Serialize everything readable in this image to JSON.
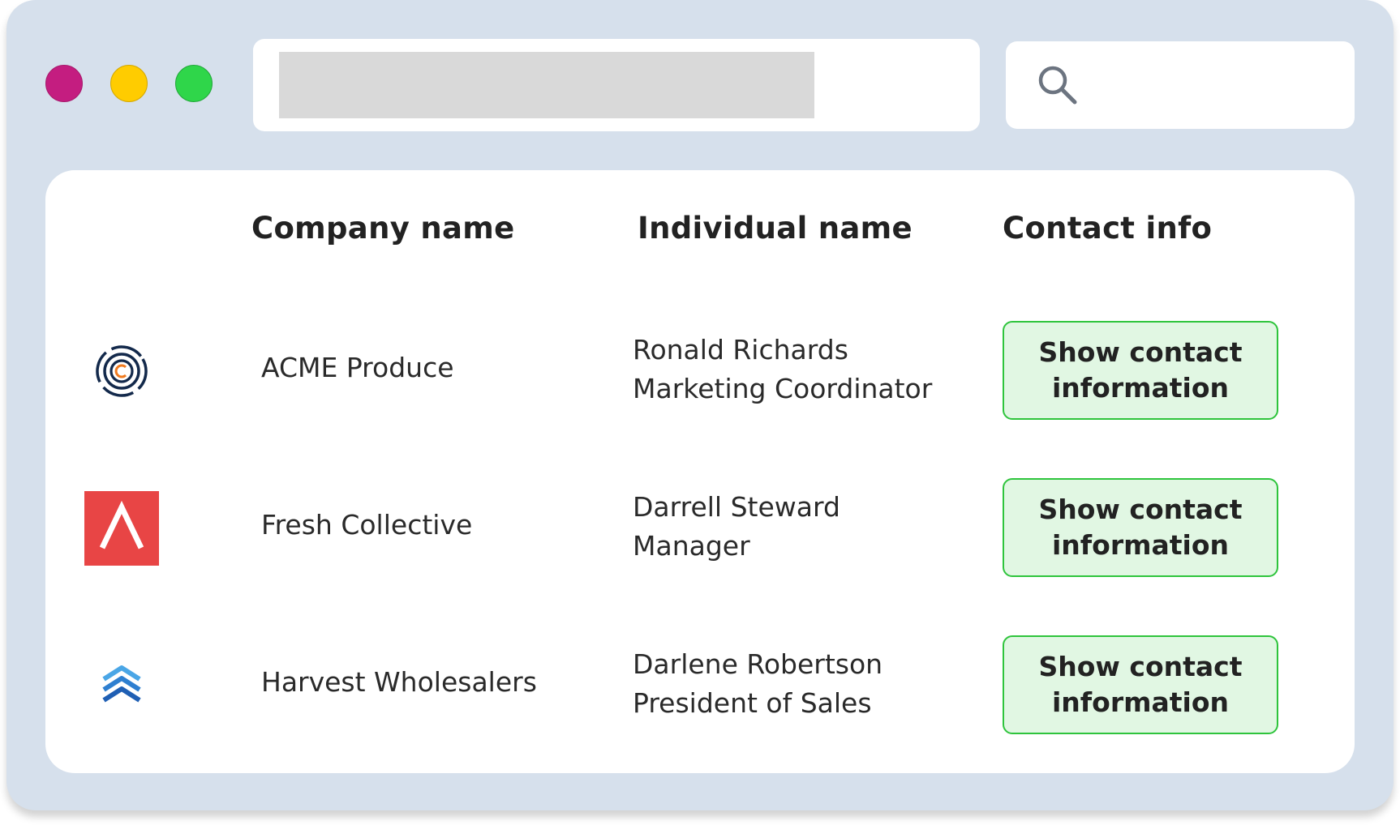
{
  "window_controls": [
    {
      "name": "close",
      "color": "#c41d80"
    },
    {
      "name": "minimize",
      "color": "#ffcc00"
    },
    {
      "name": "maximize",
      "color": "#2fd64a"
    }
  ],
  "search": {
    "icon": "search-icon"
  },
  "table": {
    "headers": {
      "company": "Company name",
      "individual": "Individual name",
      "contact": "Contact info"
    },
    "rows": [
      {
        "logo": "concentric-c-logo-icon",
        "company": "ACME Produce",
        "name": "Ronald Richards",
        "title": "Marketing Coordinator",
        "button": "Show contact information"
      },
      {
        "logo": "red-chevron-logo-icon",
        "company": "Fresh Collective",
        "name": "Darrell Steward",
        "title": "Manager",
        "button": "Show contact information"
      },
      {
        "logo": "blue-chevrons-logo-icon",
        "company": "Harvest Wholesalers",
        "name": "Darlene Robertson",
        "title": "President of Sales",
        "button": "Show contact information"
      }
    ]
  },
  "colors": {
    "frame": "#d6e0ec",
    "button_bg": "#e1f7e3",
    "button_border": "#2ec43c"
  }
}
